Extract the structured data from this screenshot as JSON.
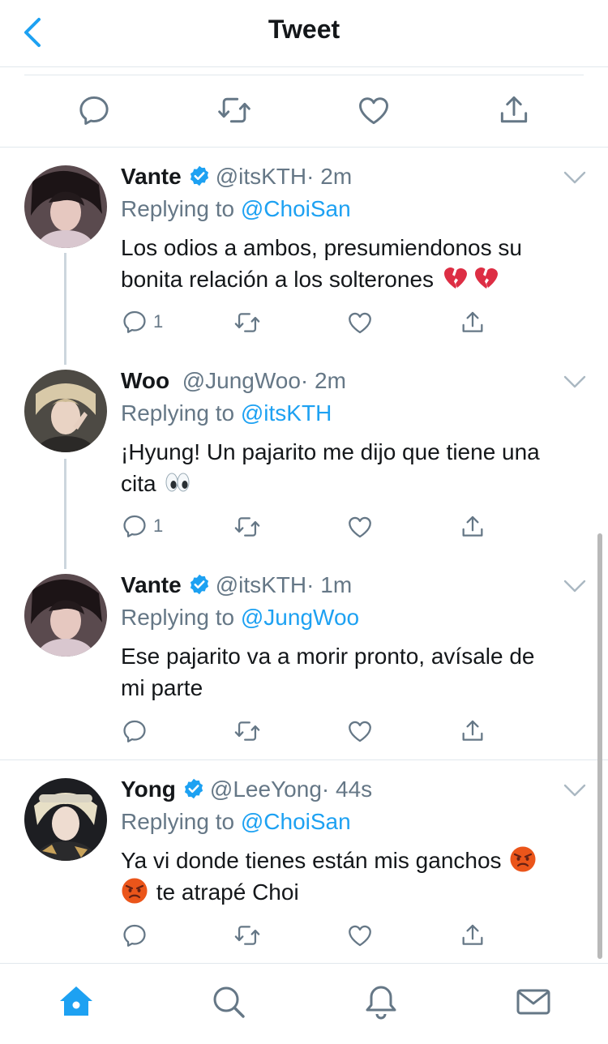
{
  "header": {
    "title": "Tweet",
    "back_icon": "chevron-left-icon"
  },
  "colors": {
    "accent": "#1da1f2",
    "muted": "#657786",
    "text": "#14171a",
    "divider": "#e1e8ed"
  },
  "main_actions": [
    "reply-icon",
    "retweet-icon",
    "like-icon",
    "share-icon"
  ],
  "replies": [
    {
      "name": "Vante",
      "verified": true,
      "handle": "@itsKTH",
      "time": "· 2m",
      "replying_label": "Replying to",
      "replying_to": "@ChoiSan",
      "text_line1": "Los odios a ambos, presumiendonos su",
      "text_line2": "bonita relación a los solterones",
      "emojis": [
        "broken-heart",
        "broken-heart"
      ],
      "reply_count": "1"
    },
    {
      "name": "Woo",
      "verified": false,
      "handle": "@JungWoo",
      "time": "· 2m",
      "replying_label": "Replying to",
      "replying_to": "@itsKTH",
      "text_line1": "¡Hyung! Un pajarito me dijo que tiene una",
      "text_line2": "cita",
      "emojis": [
        "eyes"
      ],
      "reply_count": "1"
    },
    {
      "name": "Vante",
      "verified": true,
      "handle": "@itsKTH",
      "time": "· 1m",
      "replying_label": "Replying to",
      "replying_to": "@JungWoo",
      "text_line1": "Ese pajarito va a morir pronto, avísale de",
      "text_line2": "mi parte",
      "emojis": [],
      "reply_count": ""
    },
    {
      "name": "Yong",
      "verified": true,
      "handle": "@LeeYong",
      "time": "· 44s",
      "replying_label": "Replying to",
      "replying_to": "@ChoiSan",
      "text_line1": "Ya vi donde tienes están mis ganchos",
      "text_line2": "te atrapé Choi",
      "emojis": [
        "angry-face",
        "angry-face"
      ],
      "reply_count": ""
    }
  ],
  "tabbar": [
    {
      "icon": "home-icon",
      "active": true
    },
    {
      "icon": "search-icon",
      "active": false
    },
    {
      "icon": "notifications-icon",
      "active": false
    },
    {
      "icon": "messages-icon",
      "active": false
    }
  ]
}
